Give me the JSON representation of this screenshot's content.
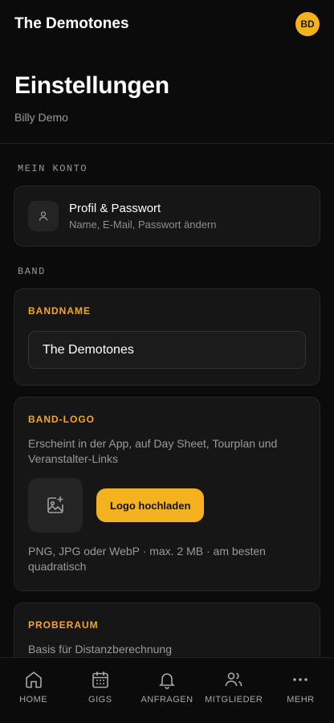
{
  "header": {
    "app_title": "The Demotones",
    "avatar_initials": "BD"
  },
  "page": {
    "title": "Einstellungen",
    "subtitle": "Billy Demo"
  },
  "account": {
    "section_label": "MEIN KONTO",
    "profile_title": "Profil & Passwort",
    "profile_sub": "Name, E-Mail, Passwort ändern"
  },
  "band": {
    "section_label": "BAND",
    "name_label": "BANDNAME",
    "name_value": "The Demotones",
    "logo_label": "BAND-LOGO",
    "logo_desc": "Erscheint in der App, auf Day Sheet, Tourplan und Veranstalter-Links",
    "upload_label": "Logo hochladen",
    "logo_hint": "PNG, JPG oder WebP · max. 2 MB · am besten quadratisch",
    "rehearsal_label": "PROBERAUM",
    "rehearsal_desc": "Basis für Distanzberechnung"
  },
  "nav": {
    "home": "HOME",
    "gigs": "GIGS",
    "requests": "ANFRAGEN",
    "members": "MITGLIEDER",
    "more": "MEHR"
  },
  "colors": {
    "accent": "#f5a623",
    "button": "#f5b21f",
    "background": "#0b0b0b"
  }
}
